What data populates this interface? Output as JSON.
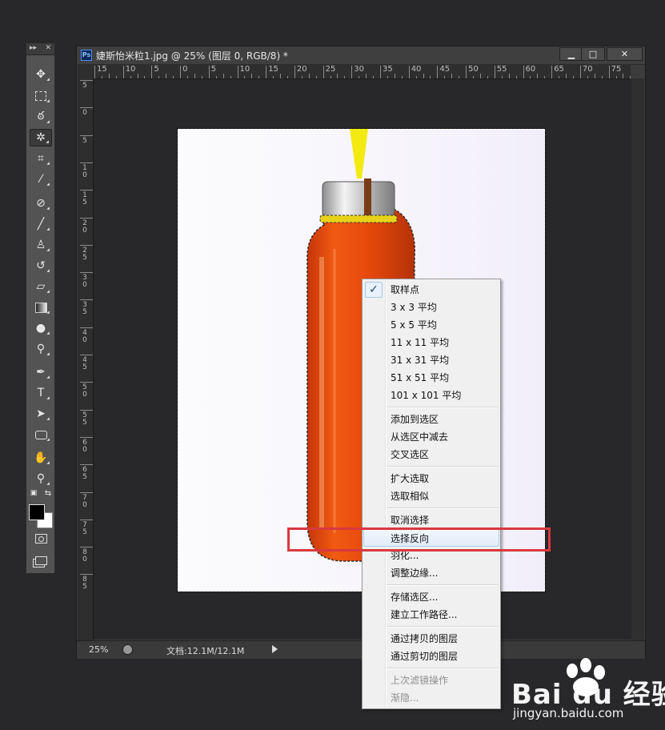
{
  "document": {
    "title": "婕斯怡米粒1.jpg @ 25% (图层 0, RGB/8) *",
    "ps_badge": "Ps",
    "min_glyph": "▁",
    "max_glyph": "□",
    "close_glyph": "✕"
  },
  "toolbar": {
    "header_left": "▸▸",
    "header_right": "✕",
    "tools": [
      "move-tool",
      "marquee-tool",
      "lasso-tool",
      "magic-wand-tool",
      "crop-tool",
      "eyedropper-tool",
      "spot-healing-tool",
      "brush-tool",
      "clone-stamp-tool",
      "history-brush-tool",
      "eraser-tool",
      "gradient-tool",
      "blur-tool",
      "dodge-tool",
      "pen-tool",
      "type-tool",
      "path-selection-tool",
      "shape-tool",
      "hand-tool",
      "zoom-tool"
    ],
    "selected_tool": "magic-wand-tool",
    "foreground_color": "#000000",
    "background_color": "#ffffff"
  },
  "ruler_h_labels": [
    "15",
    "10",
    "5",
    "0",
    "5",
    "10",
    "15",
    "20",
    "25",
    "30",
    "35",
    "40",
    "45",
    "50",
    "55",
    "60",
    "65",
    "70",
    "75"
  ],
  "ruler_v_labels": [
    "5",
    "0",
    "5",
    "10",
    "15",
    "20",
    "25",
    "30",
    "35",
    "40",
    "45",
    "50",
    "55",
    "60",
    "65",
    "70",
    "75",
    "80",
    "85"
  ],
  "status": {
    "zoom": "25%",
    "doc_size": "文档:12.1M/12.1M"
  },
  "context_menu": {
    "checked_item": "取样点",
    "highlighted_item": "选择反向",
    "groups": [
      [
        "取样点",
        "3 x 3 平均",
        "5 x 5 平均",
        "11 x 11 平均",
        "31 x 31 平均",
        "51 x 51 平均",
        "101 x 101 平均"
      ],
      [
        "添加到选区",
        "从选区中减去",
        "交叉选区"
      ],
      [
        "扩大选取",
        "选取相似"
      ],
      [
        "取消选择",
        "选择反向",
        "羽化...",
        "调整边缘..."
      ],
      [
        "存储选区...",
        "建立工作路径..."
      ],
      [
        "通过拷贝的图层",
        "通过剪切的图层"
      ],
      [
        "上次滤镜操作",
        "渐隐..."
      ]
    ],
    "disabled_items": [
      "上次滤镜操作",
      "渐隐..."
    ]
  },
  "watermark": {
    "logo": "Bai du 经验",
    "url": "jingyan.baidu.com"
  },
  "colors": {
    "highlight_frame": "#d8393f",
    "bottle_liquid": "#e24a10",
    "selection_yellow": "#f2ea10"
  }
}
